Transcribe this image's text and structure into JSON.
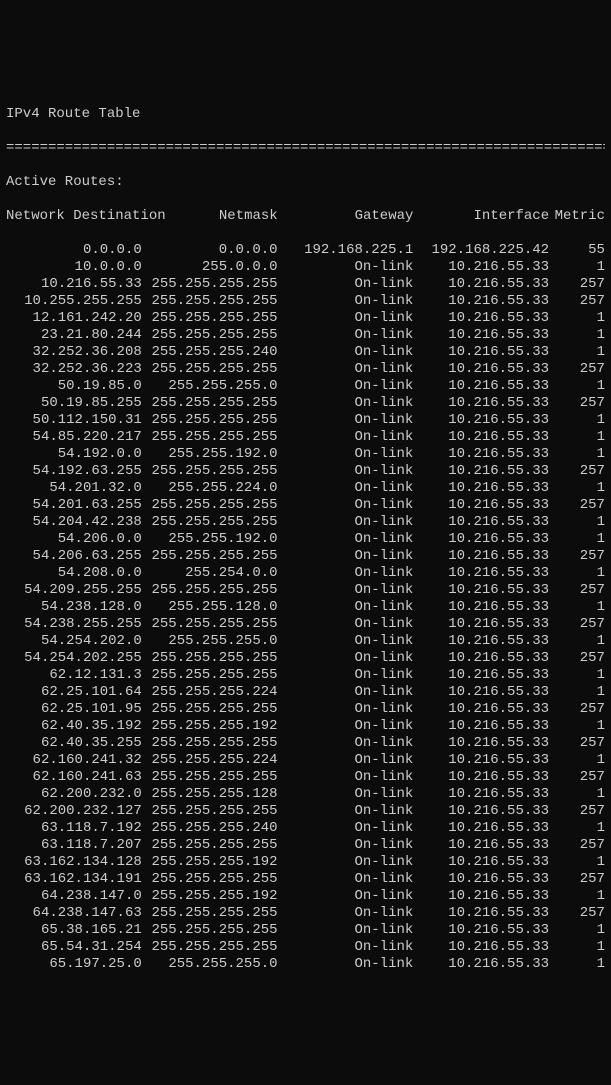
{
  "title": "IPv4 Route Table",
  "divider": "===========================================================================",
  "active_routes_label": "Active Routes:",
  "headers": {
    "destination": "Network Destination",
    "netmask": "Netmask",
    "gateway": "Gateway",
    "interface": "Interface",
    "metric": "Metric"
  },
  "routes": [
    {
      "dest": "0.0.0.0",
      "mask": "0.0.0.0",
      "gw": "192.168.225.1",
      "if": "192.168.225.42",
      "metric": "55"
    },
    {
      "dest": "10.0.0.0",
      "mask": "255.0.0.0",
      "gw": "On-link",
      "if": "10.216.55.33",
      "metric": "1"
    },
    {
      "dest": "10.216.55.33",
      "mask": "255.255.255.255",
      "gw": "On-link",
      "if": "10.216.55.33",
      "metric": "257"
    },
    {
      "dest": "10.255.255.255",
      "mask": "255.255.255.255",
      "gw": "On-link",
      "if": "10.216.55.33",
      "metric": "257"
    },
    {
      "dest": "12.161.242.20",
      "mask": "255.255.255.255",
      "gw": "On-link",
      "if": "10.216.55.33",
      "metric": "1"
    },
    {
      "dest": "23.21.80.244",
      "mask": "255.255.255.255",
      "gw": "On-link",
      "if": "10.216.55.33",
      "metric": "1"
    },
    {
      "dest": "32.252.36.208",
      "mask": "255.255.255.240",
      "gw": "On-link",
      "if": "10.216.55.33",
      "metric": "1"
    },
    {
      "dest": "32.252.36.223",
      "mask": "255.255.255.255",
      "gw": "On-link",
      "if": "10.216.55.33",
      "metric": "257"
    },
    {
      "dest": "50.19.85.0",
      "mask": "255.255.255.0",
      "gw": "On-link",
      "if": "10.216.55.33",
      "metric": "1"
    },
    {
      "dest": "50.19.85.255",
      "mask": "255.255.255.255",
      "gw": "On-link",
      "if": "10.216.55.33",
      "metric": "257"
    },
    {
      "dest": "50.112.150.31",
      "mask": "255.255.255.255",
      "gw": "On-link",
      "if": "10.216.55.33",
      "metric": "1"
    },
    {
      "dest": "54.85.220.217",
      "mask": "255.255.255.255",
      "gw": "On-link",
      "if": "10.216.55.33",
      "metric": "1"
    },
    {
      "dest": "54.192.0.0",
      "mask": "255.255.192.0",
      "gw": "On-link",
      "if": "10.216.55.33",
      "metric": "1"
    },
    {
      "dest": "54.192.63.255",
      "mask": "255.255.255.255",
      "gw": "On-link",
      "if": "10.216.55.33",
      "metric": "257"
    },
    {
      "dest": "54.201.32.0",
      "mask": "255.255.224.0",
      "gw": "On-link",
      "if": "10.216.55.33",
      "metric": "1"
    },
    {
      "dest": "54.201.63.255",
      "mask": "255.255.255.255",
      "gw": "On-link",
      "if": "10.216.55.33",
      "metric": "257"
    },
    {
      "dest": "54.204.42.238",
      "mask": "255.255.255.255",
      "gw": "On-link",
      "if": "10.216.55.33",
      "metric": "1"
    },
    {
      "dest": "54.206.0.0",
      "mask": "255.255.192.0",
      "gw": "On-link",
      "if": "10.216.55.33",
      "metric": "1"
    },
    {
      "dest": "54.206.63.255",
      "mask": "255.255.255.255",
      "gw": "On-link",
      "if": "10.216.55.33",
      "metric": "257"
    },
    {
      "dest": "54.208.0.0",
      "mask": "255.254.0.0",
      "gw": "On-link",
      "if": "10.216.55.33",
      "metric": "1"
    },
    {
      "dest": "54.209.255.255",
      "mask": "255.255.255.255",
      "gw": "On-link",
      "if": "10.216.55.33",
      "metric": "257"
    },
    {
      "dest": "54.238.128.0",
      "mask": "255.255.128.0",
      "gw": "On-link",
      "if": "10.216.55.33",
      "metric": "1"
    },
    {
      "dest": "54.238.255.255",
      "mask": "255.255.255.255",
      "gw": "On-link",
      "if": "10.216.55.33",
      "metric": "257"
    },
    {
      "dest": "54.254.202.0",
      "mask": "255.255.255.0",
      "gw": "On-link",
      "if": "10.216.55.33",
      "metric": "1"
    },
    {
      "dest": "54.254.202.255",
      "mask": "255.255.255.255",
      "gw": "On-link",
      "if": "10.216.55.33",
      "metric": "257"
    },
    {
      "dest": "62.12.131.3",
      "mask": "255.255.255.255",
      "gw": "On-link",
      "if": "10.216.55.33",
      "metric": "1"
    },
    {
      "dest": "62.25.101.64",
      "mask": "255.255.255.224",
      "gw": "On-link",
      "if": "10.216.55.33",
      "metric": "1"
    },
    {
      "dest": "62.25.101.95",
      "mask": "255.255.255.255",
      "gw": "On-link",
      "if": "10.216.55.33",
      "metric": "257"
    },
    {
      "dest": "62.40.35.192",
      "mask": "255.255.255.192",
      "gw": "On-link",
      "if": "10.216.55.33",
      "metric": "1"
    },
    {
      "dest": "62.40.35.255",
      "mask": "255.255.255.255",
      "gw": "On-link",
      "if": "10.216.55.33",
      "metric": "257"
    },
    {
      "dest": "62.160.241.32",
      "mask": "255.255.255.224",
      "gw": "On-link",
      "if": "10.216.55.33",
      "metric": "1"
    },
    {
      "dest": "62.160.241.63",
      "mask": "255.255.255.255",
      "gw": "On-link",
      "if": "10.216.55.33",
      "metric": "257"
    },
    {
      "dest": "62.200.232.0",
      "mask": "255.255.255.128",
      "gw": "On-link",
      "if": "10.216.55.33",
      "metric": "1"
    },
    {
      "dest": "62.200.232.127",
      "mask": "255.255.255.255",
      "gw": "On-link",
      "if": "10.216.55.33",
      "metric": "257"
    },
    {
      "dest": "63.118.7.192",
      "mask": "255.255.255.240",
      "gw": "On-link",
      "if": "10.216.55.33",
      "metric": "1"
    },
    {
      "dest": "63.118.7.207",
      "mask": "255.255.255.255",
      "gw": "On-link",
      "if": "10.216.55.33",
      "metric": "257"
    },
    {
      "dest": "63.162.134.128",
      "mask": "255.255.255.192",
      "gw": "On-link",
      "if": "10.216.55.33",
      "metric": "1"
    },
    {
      "dest": "63.162.134.191",
      "mask": "255.255.255.255",
      "gw": "On-link",
      "if": "10.216.55.33",
      "metric": "257"
    },
    {
      "dest": "64.238.147.0",
      "mask": "255.255.255.192",
      "gw": "On-link",
      "if": "10.216.55.33",
      "metric": "1"
    },
    {
      "dest": "64.238.147.63",
      "mask": "255.255.255.255",
      "gw": "On-link",
      "if": "10.216.55.33",
      "metric": "257"
    },
    {
      "dest": "65.38.165.21",
      "mask": "255.255.255.255",
      "gw": "On-link",
      "if": "10.216.55.33",
      "metric": "1"
    },
    {
      "dest": "65.54.31.254",
      "mask": "255.255.255.255",
      "gw": "On-link",
      "if": "10.216.55.33",
      "metric": "1"
    },
    {
      "dest": "65.197.25.0",
      "mask": "255.255.255.0",
      "gw": "On-link",
      "if": "10.216.55.33",
      "metric": "1"
    }
  ]
}
